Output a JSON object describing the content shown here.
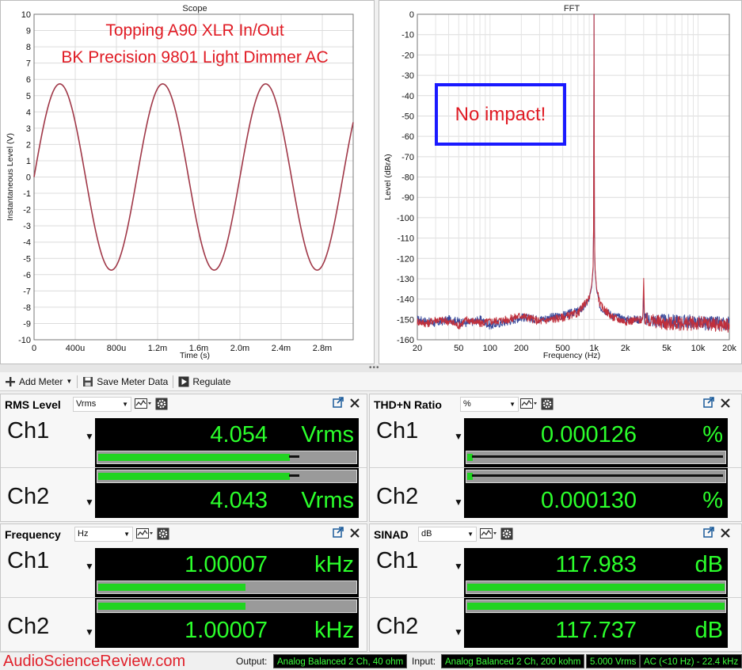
{
  "scope": {
    "title": "Scope",
    "annotation_line1": "Topping A90 XLR In/Out",
    "annotation_line2": "BK Precision 9801 Light Dimmer AC",
    "annotation_color": "#e01b24",
    "trace_color": "#a03848",
    "chart_data": {
      "type": "line",
      "xlabel": "Time (s)",
      "ylabel": "Instantaneous Level (V)",
      "xlim": [
        0,
        0.0031
      ],
      "ylim": [
        -10,
        10
      ],
      "x_tick_labels": [
        "0",
        "400u",
        "800u",
        "1.2m",
        "1.6m",
        "2.0m",
        "2.4m",
        "2.8m"
      ],
      "x_tick_values": [
        0,
        0.0004,
        0.0008,
        0.0012,
        0.0016,
        0.002,
        0.0024,
        0.0028
      ],
      "y_tick_labels": [
        "10",
        "9",
        "8",
        "7",
        "6",
        "5",
        "4",
        "3",
        "2",
        "1",
        "0",
        "-1",
        "-2",
        "-3",
        "-4",
        "-5",
        "-6",
        "-7",
        "-8",
        "-9",
        "-10"
      ],
      "y_tick_values": [
        10,
        9,
        8,
        7,
        6,
        5,
        4,
        3,
        2,
        1,
        0,
        -1,
        -2,
        -3,
        -4,
        -5,
        -6,
        -7,
        -8,
        -9,
        -10
      ],
      "series": [
        {
          "frequency_hz": 1000,
          "amplitude_v": 5.72,
          "phase_deg": 0
        }
      ],
      "grid": true
    }
  },
  "fft": {
    "title": "FFT",
    "annotation": "No impact!",
    "annotation_color": "#e01b24",
    "box_color": "#1a1aff",
    "chart_data": {
      "type": "line",
      "xlabel": "Frequency (Hz)",
      "ylabel": "Level (dBrA)",
      "x_scale": "log",
      "xlim": [
        20,
        20000
      ],
      "ylim": [
        -160,
        0
      ],
      "x_tick_labels": [
        "20",
        "50",
        "100",
        "200",
        "500",
        "1k",
        "2k",
        "5k",
        "10k",
        "20k"
      ],
      "x_tick_values": [
        20,
        50,
        100,
        200,
        500,
        1000,
        2000,
        5000,
        10000,
        20000
      ],
      "y_tick_labels": [
        "0",
        "-10",
        "-20",
        "-30",
        "-40",
        "-50",
        "-60",
        "-70",
        "-80",
        "-90",
        "-100",
        "-110",
        "-120",
        "-130",
        "-140",
        "-150",
        "-160"
      ],
      "y_tick_values": [
        0,
        -10,
        -20,
        -30,
        -40,
        -50,
        -60,
        -70,
        -80,
        -90,
        -100,
        -110,
        -120,
        -130,
        -140,
        -150,
        -160
      ],
      "series": [
        {
          "color": "#3a4a9c",
          "points": [
            [
              20,
              -150
            ],
            [
              25,
              -151
            ],
            [
              30,
              -152
            ],
            [
              40,
              -150
            ],
            [
              50,
              -151
            ],
            [
              60,
              -152
            ],
            [
              80,
              -150
            ],
            [
              100,
              -153
            ],
            [
              150,
              -151
            ],
            [
              200,
              -149
            ],
            [
              300,
              -150
            ],
            [
              500,
              -148
            ],
            [
              700,
              -146
            ],
            [
              800,
              -144
            ],
            [
              900,
              -140
            ],
            [
              950,
              -134
            ],
            [
              980,
              -125
            ],
            [
              995,
              -95
            ],
            [
              1000,
              0
            ],
            [
              1005,
              -95
            ],
            [
              1020,
              -125
            ],
            [
              1060,
              -136
            ],
            [
              1150,
              -144
            ],
            [
              1500,
              -148
            ],
            [
              2000,
              -150
            ],
            [
              2950,
              -150
            ],
            [
              3000,
              -135
            ],
            [
              3050,
              -150
            ],
            [
              5000,
              -151
            ],
            [
              8000,
              -151
            ],
            [
              12000,
              -152
            ],
            [
              20000,
              -152
            ]
          ]
        },
        {
          "color": "#c0303c",
          "points": [
            [
              20,
              -151
            ],
            [
              25,
              -152
            ],
            [
              30,
              -150
            ],
            [
              40,
              -151
            ],
            [
              50,
              -153
            ],
            [
              60,
              -150
            ],
            [
              80,
              -152
            ],
            [
              100,
              -151
            ],
            [
              150,
              -150
            ],
            [
              200,
              -148
            ],
            [
              300,
              -151
            ],
            [
              500,
              -149
            ],
            [
              700,
              -147
            ],
            [
              800,
              -143
            ],
            [
              900,
              -139
            ],
            [
              950,
              -133
            ],
            [
              980,
              -124
            ],
            [
              995,
              -94
            ],
            [
              1000,
              0
            ],
            [
              1005,
              -94
            ],
            [
              1020,
              -124
            ],
            [
              1060,
              -135
            ],
            [
              1150,
              -143
            ],
            [
              1500,
              -149
            ],
            [
              2000,
              -151
            ],
            [
              2950,
              -150
            ],
            [
              3000,
              -128
            ],
            [
              3050,
              -150
            ],
            [
              5000,
              -152
            ],
            [
              8000,
              -152
            ],
            [
              12000,
              -152
            ],
            [
              20000,
              -153
            ]
          ]
        }
      ],
      "grid": true
    }
  },
  "toolbar": {
    "add_meter": "Add Meter",
    "save_meter_data": "Save Meter Data",
    "regulate": "Regulate"
  },
  "meters": {
    "rms": {
      "title": "RMS Level",
      "unit_select": "Vrms",
      "ch1": {
        "label": "Ch1",
        "value": "4.054",
        "unit": "Vrms",
        "level": 0.74,
        "peak": 0.78
      },
      "ch2": {
        "label": "Ch2",
        "value": "4.043",
        "unit": "Vrms",
        "level": 0.74,
        "peak": 0.78
      }
    },
    "thdn": {
      "title": "THD+N Ratio",
      "unit_select": "%",
      "ch1": {
        "label": "Ch1",
        "value": "0.000126",
        "unit": "%",
        "level": 0.02,
        "peak": 0.99
      },
      "ch2": {
        "label": "Ch2",
        "value": "0.000130",
        "unit": "%",
        "level": 0.02,
        "peak": 0.99
      }
    },
    "freq": {
      "title": "Frequency",
      "unit_select": "Hz",
      "ch1": {
        "label": "Ch1",
        "value": "1.00007",
        "unit": "kHz",
        "level": 0.57,
        "peak": 0
      },
      "ch2": {
        "label": "Ch2",
        "value": "1.00007",
        "unit": "kHz",
        "level": 0.57,
        "peak": 0
      }
    },
    "sinad": {
      "title": "SINAD",
      "unit_select": "dB",
      "ch1": {
        "label": "Ch1",
        "value": "117.983",
        "unit": "dB",
        "level": 0.995,
        "peak": 0
      },
      "ch2": {
        "label": "Ch2",
        "value": "117.737",
        "unit": "dB",
        "level": 0.995,
        "peak": 0
      }
    }
  },
  "status": {
    "watermark": "AudioScienceReview.com",
    "output_label": "Output:",
    "output_value": "Analog Balanced 2 Ch, 40 ohm",
    "input_label": "Input:",
    "input_value": "Analog Balanced 2 Ch, 200 kohm",
    "input_range": "5.000 Vrms",
    "input_filter": "AC (<10 Hz) - 22.4 kHz"
  }
}
